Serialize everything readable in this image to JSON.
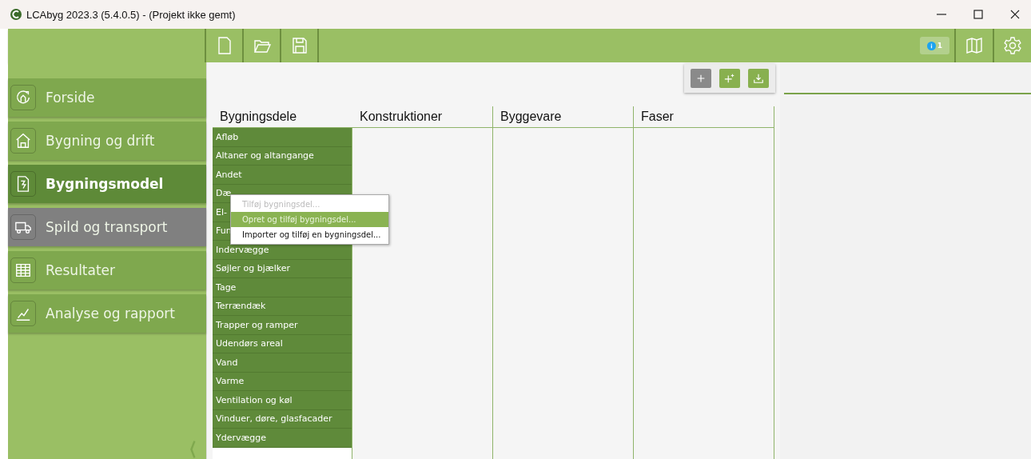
{
  "window": {
    "title": "LCAbyg 2023.3 (5.4.0.5) - (Projekt ikke gemt)"
  },
  "toolbar": {
    "notification_count": "1"
  },
  "sidebar": {
    "items": [
      {
        "label": "Forside",
        "kind": "home",
        "selected": false,
        "hovered": false
      },
      {
        "label": "Bygning og drift",
        "kind": "house",
        "selected": false,
        "hovered": false
      },
      {
        "label": "Bygningsmodel",
        "kind": "document",
        "selected": true,
        "hovered": false
      },
      {
        "label": "Spild og transport",
        "kind": "truck",
        "selected": false,
        "hovered": true
      },
      {
        "label": "Resultater",
        "kind": "table",
        "selected": false,
        "hovered": false
      },
      {
        "label": "Analyse og rapport",
        "kind": "chart",
        "selected": false,
        "hovered": false
      }
    ]
  },
  "actions": [
    {
      "kind": "plus",
      "disabled": true
    },
    {
      "kind": "plus-star",
      "disabled": false
    },
    {
      "kind": "download",
      "disabled": false
    }
  ],
  "table": {
    "columns": [
      "Bygningsdele",
      "Konstruktioner",
      "Byggevare",
      "Faser"
    ],
    "rows": [
      "Afløb",
      "Altaner og altangange",
      "Andet",
      "Dæ",
      "El-",
      "Fun",
      "Indervægge",
      "Søjler og bjælker",
      "Tage",
      "Terrændæk",
      "Trapper og ramper",
      "Udendørs areal",
      "Vand",
      "Varme",
      "Ventilation og køl",
      "Vinduer, døre, glasfacader",
      "Ydervægge"
    ]
  },
  "context_menu": {
    "items": [
      {
        "label": "Tilføj bygningsdel...",
        "disabled": true,
        "highlighted": false
      },
      {
        "label": "Opret og tilføj bygningsdel...",
        "disabled": false,
        "highlighted": true
      },
      {
        "label": "Importer og tilføj en bygningsdel...",
        "disabled": false,
        "highlighted": false
      }
    ]
  }
}
